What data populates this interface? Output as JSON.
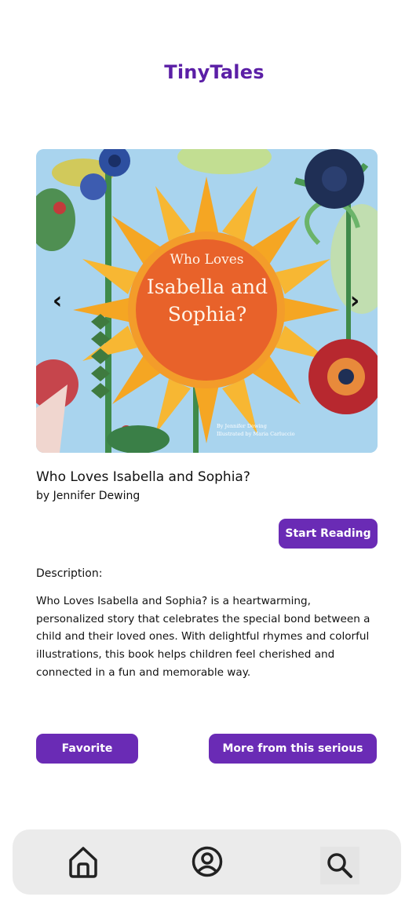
{
  "app": {
    "title": "TinyTales"
  },
  "carousel": {
    "prev_icon": "chevron-left-icon",
    "next_icon": "chevron-right-icon",
    "prev_glyph": "‹",
    "next_glyph": "›",
    "cover": {
      "pre_title": "Who Loves",
      "main_title": "Isabella and Sophia?",
      "credit_author": "By Jennifer Dewing",
      "credit_illustrator": "Illustrated by Maria Carluccio"
    }
  },
  "book": {
    "title": "Who Loves Isabella and Sophia?",
    "author": "by Jennifer Dewing"
  },
  "actions": {
    "start_reading": "Start Reading",
    "favorite": "Favorite",
    "more_series": "More from this serious"
  },
  "description": {
    "heading": "Description:",
    "body": "Who Loves Isabella and Sophia? is a heartwarming, personalized story that celebrates the special bond between a child and their loved ones. With delightful rhymes and colorful illustrations, this book helps children feel cherished and connected in a fun and memorable way."
  },
  "bottom_nav": {
    "items": [
      {
        "name": "home",
        "icon": "home-icon"
      },
      {
        "name": "profile",
        "icon": "user-circle-icon"
      },
      {
        "name": "search",
        "icon": "search-icon"
      }
    ]
  },
  "colors": {
    "brand": "#5b1fa6",
    "button": "#6a2bb5",
    "nav_background": "#ebebeb",
    "cover_sky": "#a9d4ee",
    "cover_sun": "#f5a623",
    "cover_center": "#e8622a"
  }
}
